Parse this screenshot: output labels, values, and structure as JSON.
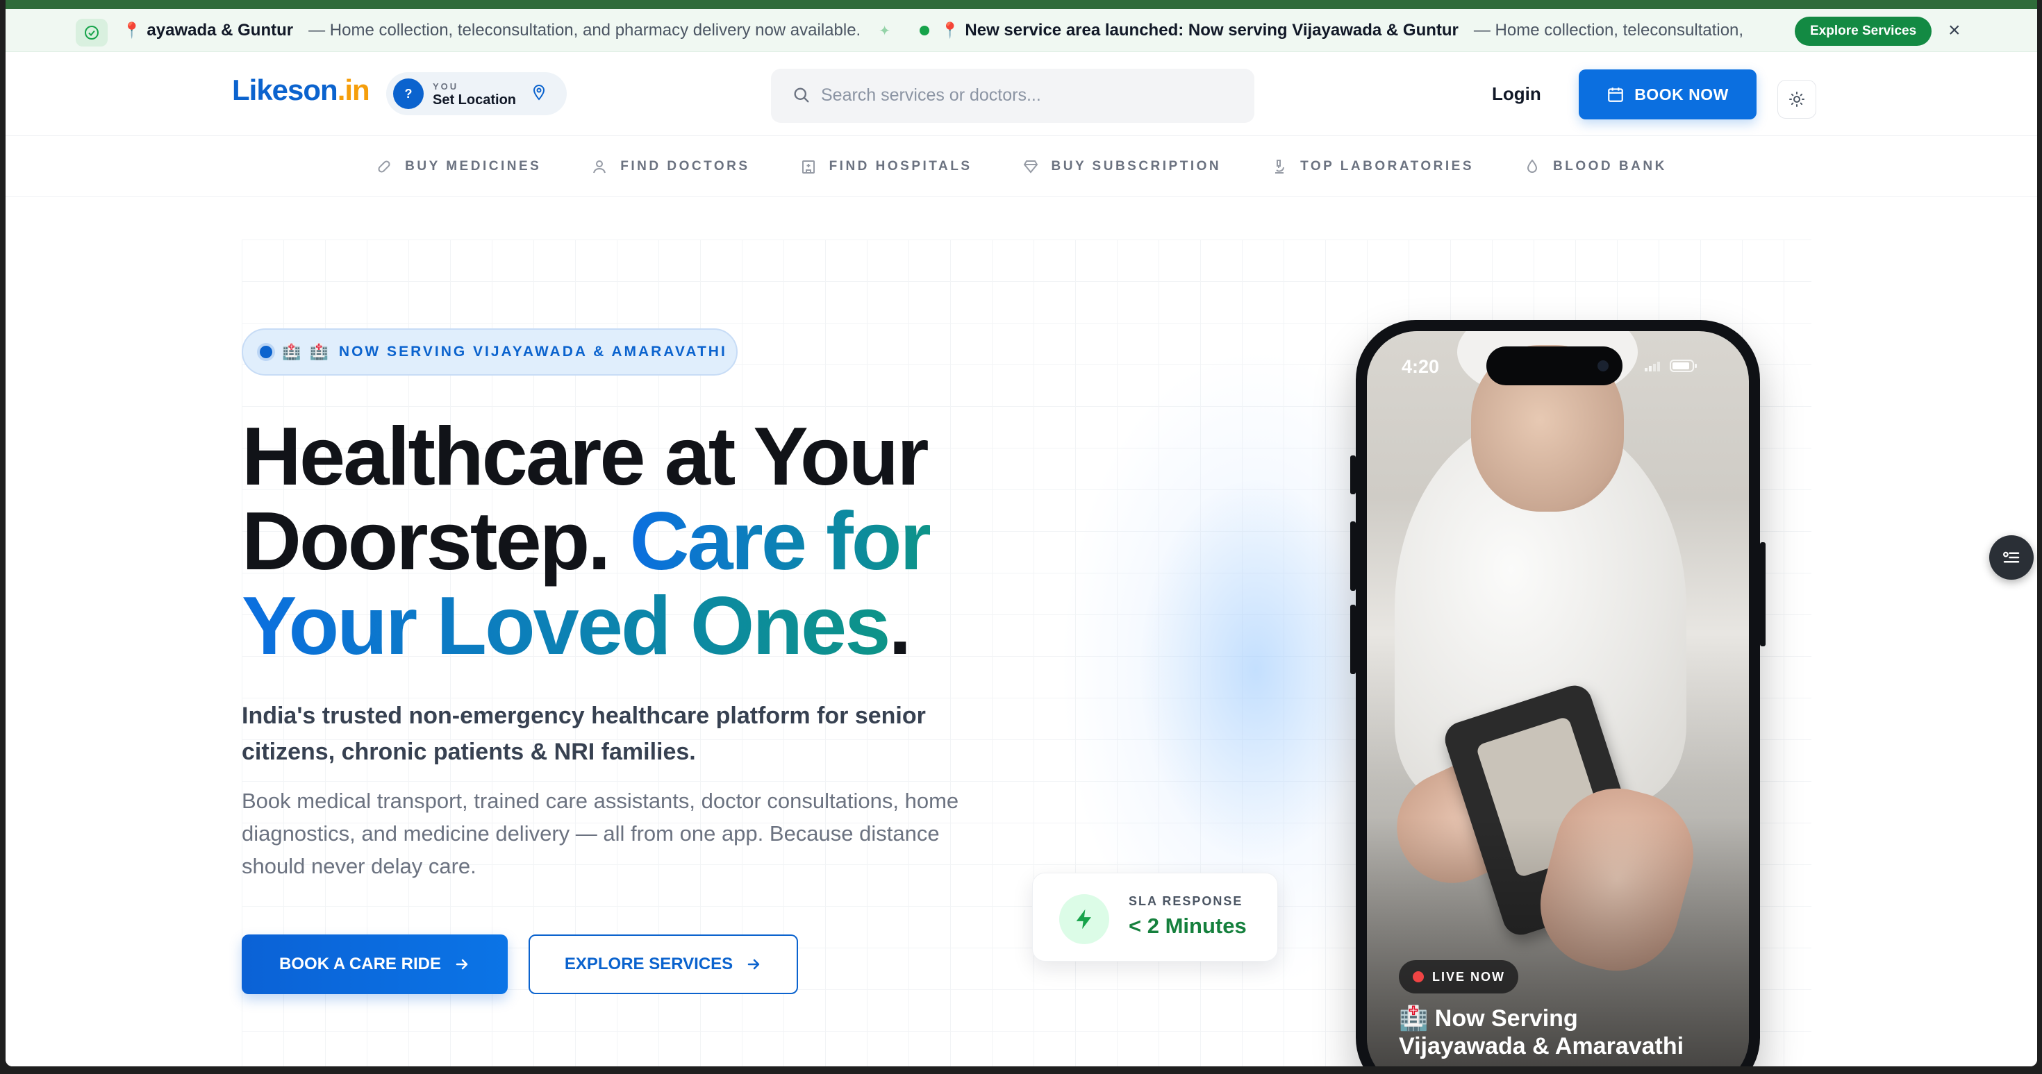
{
  "ticker": {
    "item1_place": "ayawada & Guntur",
    "item1_text": "— Home collection, teleconsultation, and pharmacy delivery now available.",
    "item2_title": "New service area launched: Now serving Vijayawada & Guntur",
    "item2_text": "— Home collection, teleconsultation,",
    "explore_label": "Explore Services",
    "close_glyph": "×"
  },
  "header": {
    "logo_main": "Likeson",
    "logo_suffix": ".in",
    "location_small": "YOU",
    "location_label": "Set Location",
    "location_q": "?",
    "search_placeholder": "Search services or doctors...",
    "login_label": "Login",
    "book_now_label": "BOOK NOW"
  },
  "nav": {
    "items": [
      {
        "label": "BUY MEDICINES",
        "icon": "pill-icon"
      },
      {
        "label": "FIND DOCTORS",
        "icon": "user-icon"
      },
      {
        "label": "FIND HOSPITALS",
        "icon": "hospital-icon"
      },
      {
        "label": "BUY SUBSCRIPTION",
        "icon": "diamond-icon"
      },
      {
        "label": "TOP LABORATORIES",
        "icon": "microscope-icon"
      },
      {
        "label": "BLOOD BANK",
        "icon": "droplet-icon"
      }
    ]
  },
  "hero": {
    "badge_emoji": "🏥 🏥",
    "badge_text": "NOW SERVING VIJAYAWADA & AMARAVATHI",
    "headline_line1": "Healthcare at Your",
    "headline_line2a": "Doorstep.",
    "headline_line2b": "Care for",
    "headline_line3": "Your Loved Ones",
    "headline_period": ".",
    "subline": "India's trusted non-emergency healthcare platform for senior citizens, chronic patients & NRI families.",
    "description": "Book medical transport, trained care assistants, doctor consultations, home diagnostics, and medicine delivery — all from one app. Because distance should never delay care.",
    "cta_primary": "BOOK A CARE RIDE",
    "cta_secondary": "EXPLORE SERVICES"
  },
  "sla": {
    "label": "SLA RESPONSE",
    "value": "< 2 Minutes"
  },
  "phone": {
    "time": "4:20",
    "live_label": "LIVE NOW",
    "title_line1": "🏥 Now Serving",
    "title_line2": "Vijayawada & Amaravathi"
  },
  "colors": {
    "brand_blue": "#0b63ce",
    "brand_green": "#138a43",
    "accent_teal": "#0d9488"
  }
}
